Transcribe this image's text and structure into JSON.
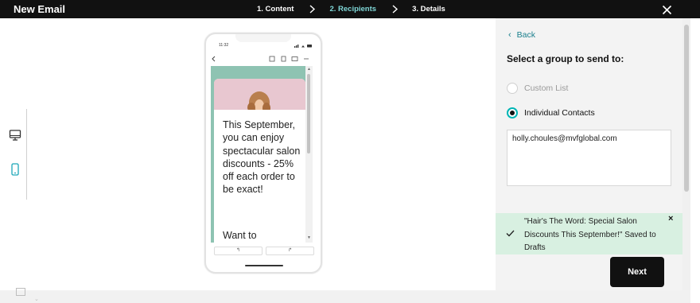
{
  "header": {
    "title": "New Email",
    "steps": [
      {
        "label": "1. Content",
        "active": false
      },
      {
        "label": "2. Recipients",
        "active": true
      },
      {
        "label": "3. Details",
        "active": false
      }
    ],
    "close_icon": "close-icon"
  },
  "preview": {
    "device_icons": [
      "desktop-icon",
      "mobile-icon"
    ],
    "status_time": "11:32",
    "promo_text": "This September, you can enjoy spectacular salon discounts - 25% off each order to be exact!",
    "promo_text_2": "Want to",
    "nav_left": "↰",
    "nav_right": "↱"
  },
  "side": {
    "back_label": "Back",
    "group_title": "Select a group to send to:",
    "options": [
      {
        "label": "Custom List",
        "selected": false
      },
      {
        "label": "Individual Contacts",
        "selected": true
      }
    ],
    "email_value": "holly.choules@mvfglobal.com"
  },
  "toast": {
    "message": "\"Hair's The Word: Special Salon Discounts This September!\" Saved to Drafts",
    "close_glyph": "×"
  },
  "actions": {
    "next_label": "Next"
  },
  "colors": {
    "header_bg": "#111111",
    "active_step": "#7fd6d6",
    "accent": "#00b5b5",
    "email_bg": "#8ec3b2",
    "toast_bg": "#d8f0e1"
  }
}
